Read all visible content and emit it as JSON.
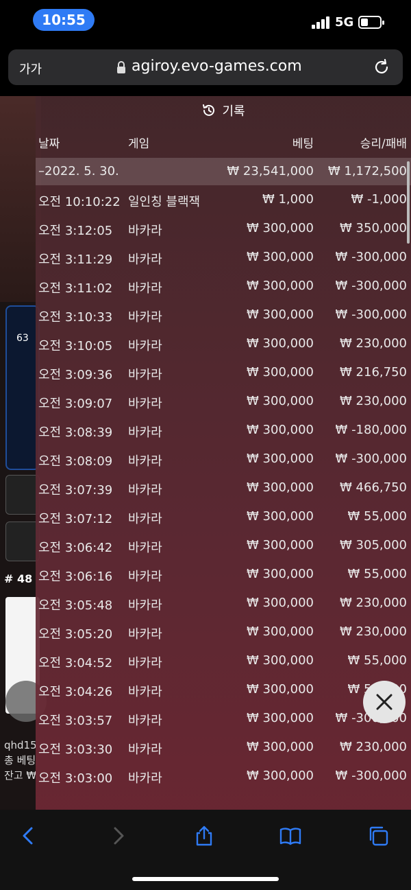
{
  "status": {
    "time": "10:55",
    "network": "5G",
    "battery_level": 0.3
  },
  "browser": {
    "text_size_label": "가가",
    "url": "agiroy.evo-games.com"
  },
  "background_page": {
    "ring_percent": "63",
    "round_label": "# 48",
    "user_lines": [
      "qhd15",
      "총 베팅",
      "잔고 ₩"
    ]
  },
  "history": {
    "title": "기록",
    "columns": {
      "date": "날짜",
      "game": "게임",
      "bet": "베팅",
      "result": "승리/패배"
    },
    "summary": {
      "date": "–2022. 5. 30.",
      "bet": "₩ 23,541,000",
      "result": "₩ 1,172,500"
    },
    "rows": [
      {
        "time": "오전 10:10:22",
        "game": "일인칭 블랙잭",
        "bet": "₩ 1,000",
        "result": "₩ -1,000"
      },
      {
        "time": "오전 3:12:05",
        "game": "바카라",
        "bet": "₩ 300,000",
        "result": "₩ 350,000"
      },
      {
        "time": "오전 3:11:29",
        "game": "바카라",
        "bet": "₩ 300,000",
        "result": "₩ -300,000"
      },
      {
        "time": "오전 3:11:02",
        "game": "바카라",
        "bet": "₩ 300,000",
        "result": "₩ -300,000"
      },
      {
        "time": "오전 3:10:33",
        "game": "바카라",
        "bet": "₩ 300,000",
        "result": "₩ -300,000"
      },
      {
        "time": "오전 3:10:05",
        "game": "바카라",
        "bet": "₩ 300,000",
        "result": "₩ 230,000"
      },
      {
        "time": "오전 3:09:36",
        "game": "바카라",
        "bet": "₩ 300,000",
        "result": "₩ 216,750"
      },
      {
        "time": "오전 3:09:07",
        "game": "바카라",
        "bet": "₩ 300,000",
        "result": "₩ 230,000"
      },
      {
        "time": "오전 3:08:39",
        "game": "바카라",
        "bet": "₩ 300,000",
        "result": "₩ -180,000"
      },
      {
        "time": "오전 3:08:09",
        "game": "바카라",
        "bet": "₩ 300,000",
        "result": "₩ -300,000"
      },
      {
        "time": "오전 3:07:39",
        "game": "바카라",
        "bet": "₩ 300,000",
        "result": "₩ 466,750"
      },
      {
        "time": "오전 3:07:12",
        "game": "바카라",
        "bet": "₩ 300,000",
        "result": "₩ 55,000"
      },
      {
        "time": "오전 3:06:42",
        "game": "바카라",
        "bet": "₩ 300,000",
        "result": "₩ 305,000"
      },
      {
        "time": "오전 3:06:16",
        "game": "바카라",
        "bet": "₩ 300,000",
        "result": "₩ 55,000"
      },
      {
        "time": "오전 3:05:48",
        "game": "바카라",
        "bet": "₩ 300,000",
        "result": "₩ 230,000"
      },
      {
        "time": "오전 3:05:20",
        "game": "바카라",
        "bet": "₩ 300,000",
        "result": "₩ 230,000"
      },
      {
        "time": "오전 3:04:52",
        "game": "바카라",
        "bet": "₩ 300,000",
        "result": "₩ 55,000"
      },
      {
        "time": "오전 3:04:26",
        "game": "바카라",
        "bet": "₩ 300,000",
        "result": "₩ 55,000"
      },
      {
        "time": "오전 3:03:57",
        "game": "바카라",
        "bet": "₩ 300,000",
        "result": "₩ -300,000"
      },
      {
        "time": "오전 3:03:30",
        "game": "바카라",
        "bet": "₩ 300,000",
        "result": "₩ 230,000"
      },
      {
        "time": "오전 3:03:00",
        "game": "바카라",
        "bet": "₩ 300,000",
        "result": "₩ -300,000"
      }
    ]
  },
  "icons": {
    "back": "chevron-left-icon",
    "forward": "chevron-right-icon",
    "share": "share-icon",
    "bookmarks": "book-icon",
    "tabs": "tabs-icon",
    "close": "close-icon",
    "history": "clock-history-icon"
  },
  "colors": {
    "accent": "#2f7bf5",
    "overlay": "#5f2a34"
  }
}
